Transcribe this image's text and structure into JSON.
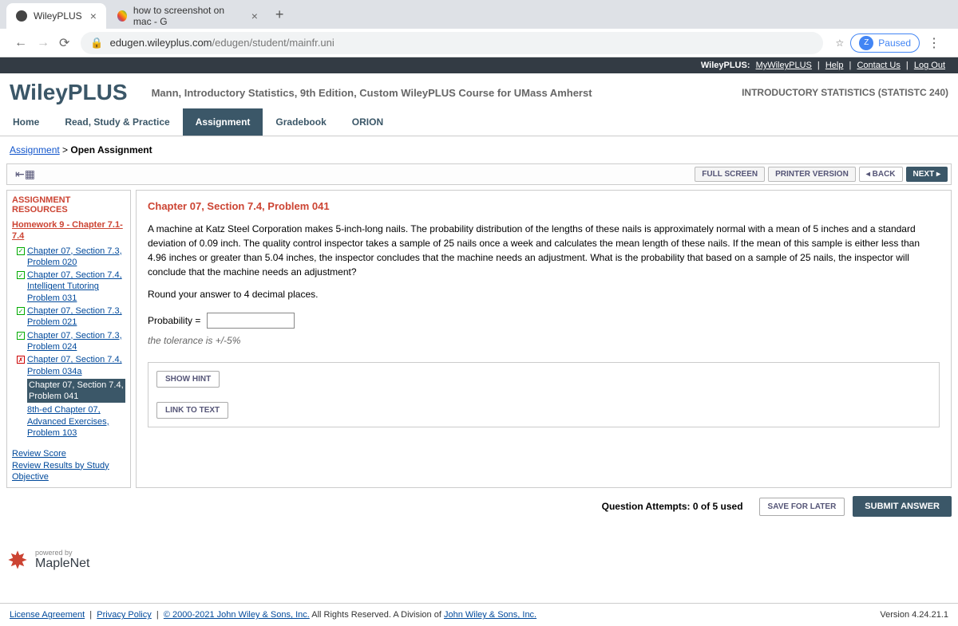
{
  "browser": {
    "tabs": [
      {
        "title": "WileyPLUS",
        "active": true
      },
      {
        "title": "how to screenshot on mac - G",
        "active": false
      }
    ],
    "url_host": "edugen.wileyplus.com",
    "url_path": "/edugen/student/mainfr.uni",
    "profile_letter": "Z",
    "profile_status": "Paused"
  },
  "top_links": {
    "brand": "WileyPLUS:",
    "items": [
      "MyWileyPLUS",
      "Help",
      "Contact Us",
      "Log Out"
    ]
  },
  "header": {
    "logo": "WileyPLUS",
    "course": "Mann, Introductory Statistics, 9th Edition, Custom WileyPLUS Course for UMass Amherst",
    "code": "INTRODUCTORY STATISTICS (STATISTC 240)"
  },
  "nav": [
    "Home",
    "Read, Study & Practice",
    "Assignment",
    "Gradebook",
    "ORION"
  ],
  "nav_active": "Assignment",
  "breadcrumb": {
    "link": "Assignment",
    "current": "Open Assignment"
  },
  "toolbar": {
    "full_screen": "FULL SCREEN",
    "printer": "PRINTER VERSION",
    "back": "BACK",
    "next": "NEXT"
  },
  "sidebar": {
    "title": "ASSIGNMENT RESOURCES",
    "hw": "Homework 9 - Chapter 7.1-7.4",
    "items": [
      {
        "label": "Chapter 07, Section 7.3, Problem 020",
        "status": "ok"
      },
      {
        "label": "Chapter 07, Section 7.4, Intelligent Tutoring Problem 031",
        "status": "ok"
      },
      {
        "label": "Chapter 07, Section 7.3, Problem 021",
        "status": "ok"
      },
      {
        "label": "Chapter 07, Section 7.3, Problem 024",
        "status": "ok"
      },
      {
        "label": "Chapter 07, Section 7.4, Problem 034a",
        "status": "bad"
      },
      {
        "label": "Chapter 07, Section 7.4, Problem 041",
        "status": "current"
      },
      {
        "label": "8th-ed Chapter 07, Advanced Exercises, Problem 103",
        "status": "none"
      }
    ],
    "review_score": "Review Score",
    "review_results": "Review Results by Study Objective"
  },
  "problem": {
    "title": "Chapter 07, Section 7.4, Problem 041",
    "text": "A machine at Katz Steel Corporation makes 5-inch-long nails. The probability distribution of the lengths of these nails is approximately normal with a mean of 5 inches and a standard deviation of 0.09 inch. The quality control inspector takes a sample of 25 nails once a week and calculates the mean length of these nails. If the mean of this sample is either less than 4.96 inches or greater than 5.04 inches, the inspector concludes that the machine needs an adjustment. What is the probability that based on a sample of 25 nails, the inspector will conclude that the machine needs an adjustment?",
    "round": "Round your answer to 4 decimal places.",
    "label": "Probability =",
    "tolerance": "the tolerance is +/-5%",
    "show_hint": "SHOW HINT",
    "link_text": "LINK TO TEXT"
  },
  "footer": {
    "attempts": "Question Attempts: 0 of 5 used",
    "save": "SAVE FOR LATER",
    "submit": "SUBMIT ANSWER"
  },
  "maplenet": {
    "powered": "powered by",
    "name": "MapleNet"
  },
  "bottom": {
    "license": "License Agreement",
    "privacy": "Privacy Policy",
    "copyright": "© 2000-2021 John Wiley & Sons, Inc.",
    "rights": " All Rights Reserved. A Division of ",
    "company": "John Wiley & Sons, Inc.",
    "version": "Version 4.24.21.1"
  }
}
